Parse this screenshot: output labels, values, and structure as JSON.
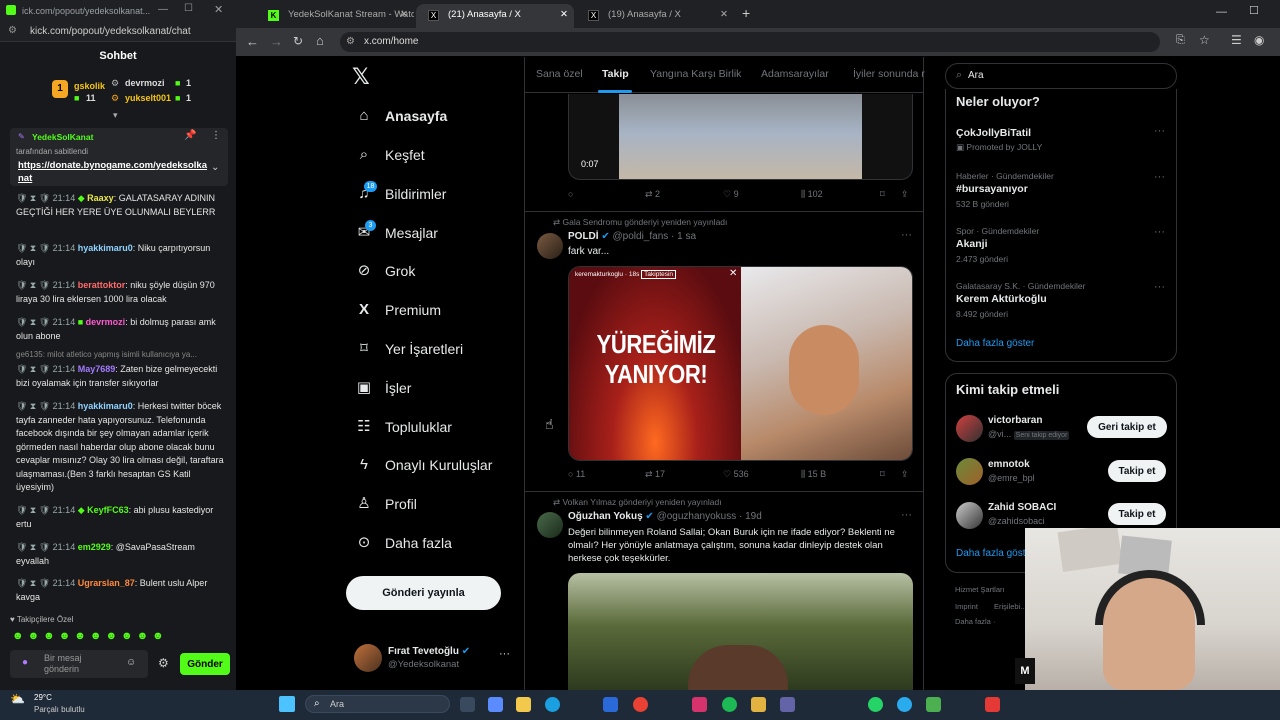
{
  "kick": {
    "title_url": "ick.com/popout/yedeksolkanat...",
    "url": "kick.com/popout/yedeksolkanat/chat",
    "header": "Sohbet",
    "leaderboard": [
      {
        "rank": "1",
        "name": "gskolik",
        "count": "11"
      },
      {
        "name": "devrmozi",
        "count": "1"
      },
      {
        "name": "yukselt001",
        "count": "1"
      }
    ],
    "pinned_user": "YedekSolKanat",
    "pinned_by": "tarafından sabitlendi",
    "pinned_link": "https://donate.bynogame.com/yedeksolkanat",
    "messages": [
      {
        "time": "21:14",
        "user": "Raaxy",
        "color": "#e8e84a",
        "text": ": GALATASARAY ADININ GEÇTİĞİ HER YERE ÜYE OLUNMALI BEYLERR"
      },
      {
        "time": "21:14",
        "user": "hyakkimaru0",
        "color": "#8fd3ff",
        "text": ": Niku çarpıtıyorsun olayı"
      },
      {
        "time": "21:14",
        "user": "berattoktor",
        "color": "#ff6b6b",
        "text": ": niku şöyle düşün 970 liraya 30 lira eklersen 1000 lira olacak"
      },
      {
        "time": "21:14",
        "user": "devrmozi",
        "color": "#ff5ad1",
        "text": ": bi dolmuş parası amk olun abone"
      },
      {
        "time": "21:14",
        "user": "May7689",
        "color": "#a27bff",
        "text": ": Zaten bize gelmeyecekti bizi oyalamak için transfer sıkıyorlar"
      },
      {
        "time": "21:14",
        "user": "hyakkimaru0",
        "color": "#8fd3ff",
        "text": ": Herkesi twitter böcek tayfa zanneder hata yapıyorsunuz. Telefonunda facebook dışında bir şey olmayan adamlar içerik görmeden nasıl haberdar olup abone olacak bunu cevaplar mısınız? Olay 30 lira olması değil, taraftara ulaşmaması.(Ben 3 farklı hesaptan GS Katil üyesiyim)"
      },
      {
        "time": "21:14",
        "user": "KeyfFC63",
        "color": "#53fc18",
        "text": ": abi plusu kastediyor ertu"
      },
      {
        "time": "21:14",
        "user": "em2929",
        "color": "#53fc18",
        "text": ": @SavaPasaStream eyvallah"
      },
      {
        "time": "21:14",
        "user": "Ugrarslan_87",
        "color": "#ff8a3c",
        "text": ": Bulent uslu Alper kavga"
      }
    ],
    "reply_hint": "ge6135: milot atletico yapmış isimli kullanıcıya ya...",
    "followers_label": "Takipçilere Özel",
    "input_placeholder": "Bir mesaj gönderin",
    "send_label": "Gönder"
  },
  "browser": {
    "tabs": [
      {
        "label": "YedekSolKanat Stream - Watch",
        "active": false
      },
      {
        "label": "(21) Anasayfa / X",
        "active": true
      },
      {
        "label": "(19) Anasayfa / X",
        "active": false
      }
    ],
    "url": "x.com/home"
  },
  "x": {
    "nav": [
      {
        "label": "Anasayfa",
        "icon": "home-icon",
        "glyph": "⌂"
      },
      {
        "label": "Keşfet",
        "icon": "search-icon",
        "glyph": "⌕"
      },
      {
        "label": "Bildirimler",
        "icon": "bell-icon",
        "glyph": "🔔",
        "badge": "18"
      },
      {
        "label": "Mesajlar",
        "icon": "mail-icon",
        "glyph": "✉",
        "badge": "3"
      },
      {
        "label": "Grok",
        "icon": "grok-icon",
        "glyph": "⊘"
      },
      {
        "label": "Premium",
        "icon": "x-icon",
        "glyph": "X"
      },
      {
        "label": "Yer İşaretleri",
        "icon": "bookmark-icon",
        "glyph": "❏"
      },
      {
        "label": "İşler",
        "icon": "briefcase-icon",
        "glyph": "▣"
      },
      {
        "label": "Topluluklar",
        "icon": "people-icon",
        "glyph": "☷"
      },
      {
        "label": "Onaylı Kuruluşlar",
        "icon": "lightning-icon",
        "glyph": "ϟ"
      },
      {
        "label": "Profil",
        "icon": "person-icon",
        "glyph": "♙"
      },
      {
        "label": "Daha fazla",
        "icon": "more-circle-icon",
        "glyph": "⊙"
      }
    ],
    "post_button": "Gönderi yayınla",
    "account": {
      "name": "Fırat Tevetoğlu",
      "handle": "@Yedeksolkanat"
    },
    "feed_tabs": [
      "Sana özel",
      "Takip",
      "Yangına Karşı Birlik",
      "Adamsarayılar",
      "İyiler sonunda r"
    ],
    "video_time": "0:07",
    "post0_stats": {
      "replies": "",
      "reposts": "2",
      "likes": "9",
      "views": "102"
    },
    "post1": {
      "repost_note": "Gala Sendromu gönderiyi yeniden yayınladı",
      "name": "POLDİ",
      "handle": "@poldi_fans · 1 sa",
      "text": "fark var...",
      "image_text": "YÜREĞİMİZ YANIYOR!",
      "story_user": "keremakturkoglu",
      "story_time": "18s",
      "story_follow": "Takiptesin",
      "stats": {
        "replies": "11",
        "reposts": "17",
        "likes": "536",
        "views": "15 B"
      }
    },
    "post2": {
      "repost_note": "Volkan Yılmaz gönderiyi yeniden yayınladı",
      "name": "Oğuzhan Yokuş",
      "handle": "@oguzhanyokuss · 19d",
      "text": "Değeri bilinmeyen Roland Sallai; Okan Buruk için ne ifade ediyor? Beklenti ne olmalı? Her yönüyle anlatmaya çalıştım, sonuna kadar dinleyip destek olan herkese çok teşekkürler."
    },
    "search_placeholder": "Ara",
    "trends_title": "Neler oluyor?",
    "trends": [
      {
        "cat": "",
        "name": "ÇokJollyBiTatil",
        "meta": "Promoted by JOLLY"
      },
      {
        "cat": "Haberler · Gündemdekiler",
        "name": "#bursayanıyor",
        "meta": "532 B gönderi"
      },
      {
        "cat": "Spor · Gündemdekiler",
        "name": "Akanji",
        "meta": "2.473 gönderi"
      },
      {
        "cat": "Galatasaray S.K. · Gündemdekiler",
        "name": "Kerem Aktürkoğlu",
        "meta": "8.492 gönderi"
      }
    ],
    "show_more": "Daha fazla göster",
    "follow_title": "Kimi takip etmeli",
    "who_to_follow": [
      {
        "name": "victorbaran",
        "handle": "@vi...",
        "note": "Seni takip ediyor",
        "button": "Geri takip et"
      },
      {
        "name": "emnotok",
        "handle": "@emre_bpl",
        "note": "",
        "button": "Takip et"
      },
      {
        "name": "Zahid SOBACI",
        "handle": "@zahidsobaci",
        "note": "",
        "button": "Takip et"
      }
    ],
    "show_more2": "Daha fazla göst",
    "footer": [
      "Hizmet Şartları",
      "Imprint",
      "Erişilebi...",
      "Daha fazla ·"
    ]
  },
  "taskbar": {
    "temp": "29°C",
    "weather": "Parçalı bulutlu",
    "search": "Ara"
  }
}
